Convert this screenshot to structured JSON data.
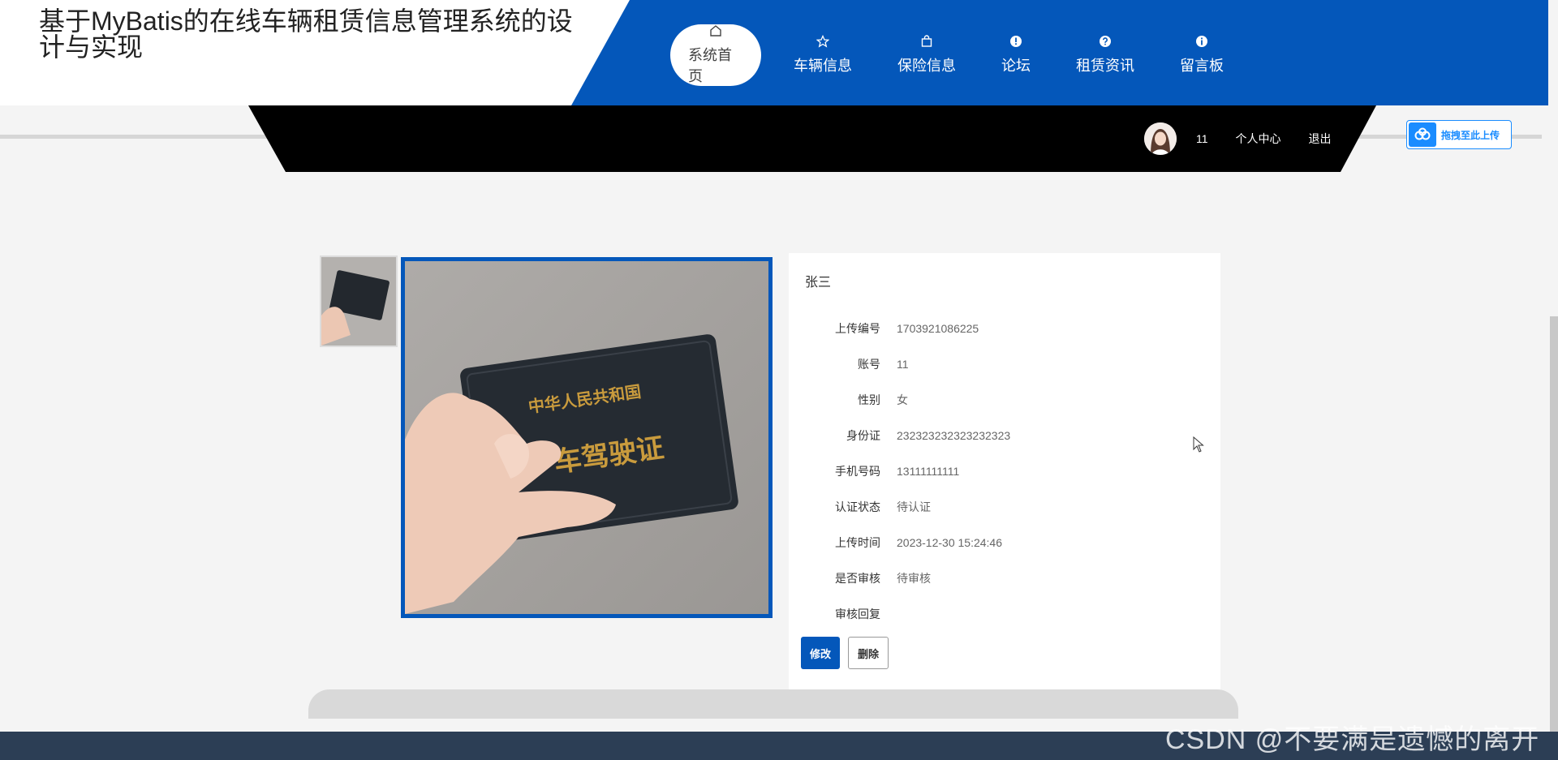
{
  "site_title": "基于MyBatis的在线车辆租赁信息管理系统的设计与实现",
  "nav": [
    {
      "label": "系统首页",
      "icon": "home-icon"
    },
    {
      "label": "车辆信息",
      "icon": "star-icon"
    },
    {
      "label": "保险信息",
      "icon": "bag-icon"
    },
    {
      "label": "论坛",
      "icon": "alert-icon"
    },
    {
      "label": "租赁资讯",
      "icon": "question-icon"
    },
    {
      "label": "留言板",
      "icon": "info-icon"
    }
  ],
  "user": {
    "account": "11",
    "center_label": "个人中心",
    "logout_label": "退出"
  },
  "upload_widget": {
    "label": "拖拽至此上传"
  },
  "detail": {
    "name": "张三",
    "fields": [
      {
        "label": "上传编号",
        "value": "1703921086225"
      },
      {
        "label": "账号",
        "value": "11"
      },
      {
        "label": "性别",
        "value": "女"
      },
      {
        "label": "身份证",
        "value": "232323232323232323"
      },
      {
        "label": "手机号码",
        "value": "13111111111"
      },
      {
        "label": "认证状态",
        "value": "待认证"
      },
      {
        "label": "上传时间",
        "value": "2023-12-30 15:24:46"
      },
      {
        "label": "是否审核",
        "value": "待审核"
      },
      {
        "label": "审核回复",
        "value": ""
      }
    ],
    "edit_label": "修改",
    "delete_label": "删除"
  },
  "image_text": {
    "line1": "中华人民共和国",
    "line2": "车驾驶证"
  },
  "watermark": "CSDN @不要满是遗憾的离开",
  "colors": {
    "primary": "#0457ba",
    "footer": "#2c3e55",
    "accent": "#1a8cff"
  }
}
